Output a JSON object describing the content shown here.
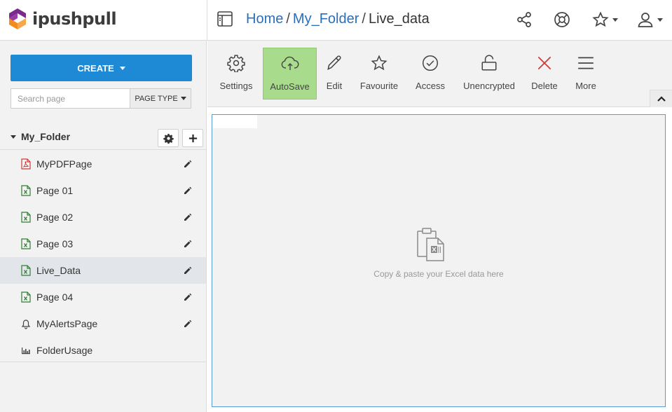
{
  "brand": {
    "name": "ipushpull",
    "colors": {
      "orange": "#f28c1c",
      "purple": "#7a2b8c",
      "blue": "#1e8ad6"
    }
  },
  "header": {
    "breadcrumb": [
      {
        "label": "Home",
        "link": true
      },
      {
        "label": "My_Folder",
        "link": true
      },
      {
        "label": "Live_data",
        "link": false
      }
    ],
    "separator": "/",
    "icons": [
      "page-layout-icon",
      "share-icon",
      "help-lifebuoy-icon",
      "star-icon",
      "user-icon"
    ]
  },
  "sidebar": {
    "create_label": "CREATE",
    "search_placeholder": "Search page",
    "page_type_label": "PAGE TYPE",
    "folder": {
      "name": "My_Folder"
    },
    "pages": [
      {
        "label": "MyPDFPage",
        "type": "pdf",
        "editable": true,
        "active": false
      },
      {
        "label": "Page 01",
        "type": "excel",
        "editable": true,
        "active": false
      },
      {
        "label": "Page 02",
        "type": "excel",
        "editable": true,
        "active": false
      },
      {
        "label": "Page 03",
        "type": "excel",
        "editable": true,
        "active": false
      },
      {
        "label": "Live_Data",
        "type": "excel",
        "editable": true,
        "active": true
      },
      {
        "label": "Page 04",
        "type": "excel",
        "editable": true,
        "active": false
      },
      {
        "label": "MyAlertsPage",
        "type": "alert",
        "editable": true,
        "active": false
      },
      {
        "label": "FolderUsage",
        "type": "usage",
        "editable": false,
        "active": false
      }
    ]
  },
  "toolbar": {
    "buttons": [
      {
        "label": "Settings",
        "icon": "gear-icon"
      },
      {
        "label": "AutoSave",
        "icon": "cloud-upload-icon",
        "active": true
      },
      {
        "label": "Edit",
        "icon": "pencil-icon"
      },
      {
        "label": "Favourite",
        "icon": "star-icon"
      },
      {
        "label": "Access",
        "icon": "check-circle-icon"
      },
      {
        "label": "Unencrypted",
        "icon": "unlock-icon"
      },
      {
        "label": "Delete",
        "icon": "close-icon"
      },
      {
        "label": "More",
        "icon": "menu-icon"
      }
    ]
  },
  "content": {
    "paste_hint": "Copy & paste your Excel data here"
  }
}
